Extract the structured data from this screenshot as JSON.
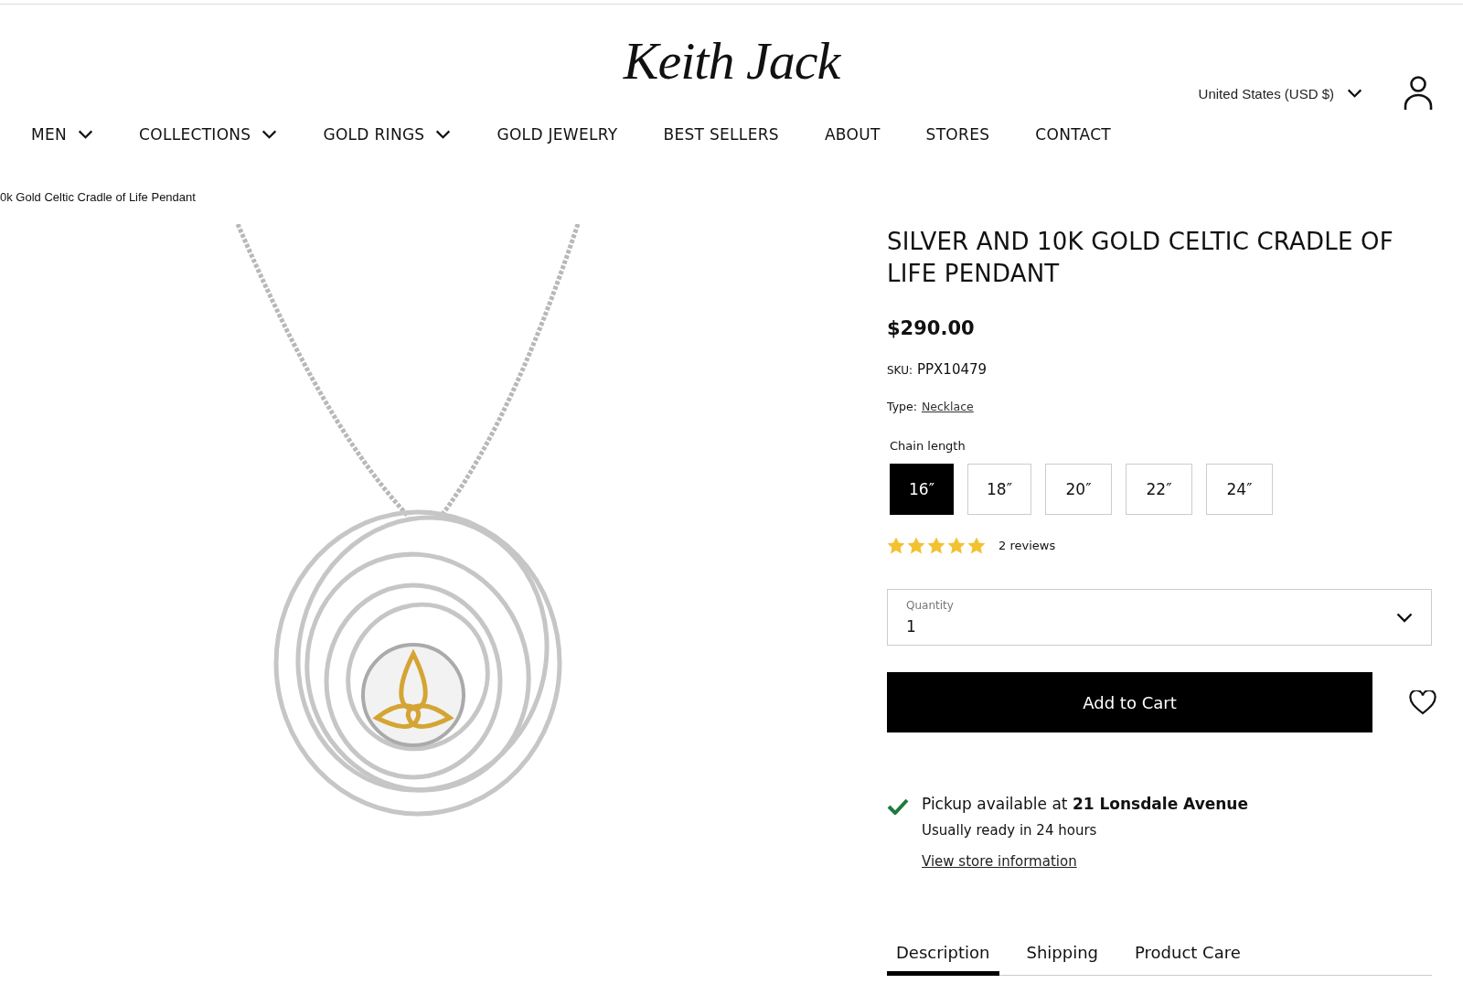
{
  "header": {
    "logo": "Keith Jack",
    "currency": "United States (USD $)"
  },
  "nav": [
    {
      "label": "MEN",
      "dropdown": true
    },
    {
      "label": "COLLECTIONS",
      "dropdown": true
    },
    {
      "label": "GOLD RINGS",
      "dropdown": true
    },
    {
      "label": "GOLD JEWELRY",
      "dropdown": false
    },
    {
      "label": "BEST SELLERS",
      "dropdown": false
    },
    {
      "label": "ABOUT",
      "dropdown": false
    },
    {
      "label": "STORES",
      "dropdown": false
    },
    {
      "label": "CONTACT",
      "dropdown": false
    }
  ],
  "breadcrumb": "0k Gold Celtic Cradle of Life Pendant",
  "product": {
    "title": "SILVER AND 10K GOLD CELTIC CRADLE OF LIFE PENDANT",
    "price": "$290.00",
    "sku_label": "SKU:",
    "sku": "PPX10479",
    "type_label": "Type:",
    "type": "Necklace",
    "option_label": "Chain length",
    "options": [
      {
        "label": "16″",
        "selected": true
      },
      {
        "label": "18″",
        "selected": false
      },
      {
        "label": "20″",
        "selected": false
      },
      {
        "label": "22″",
        "selected": false
      },
      {
        "label": "24″",
        "selected": false
      }
    ],
    "stars": 5,
    "reviews": "2 reviews",
    "quantity": {
      "label": "Quantity",
      "value": "1"
    },
    "add_to_cart": "Add to Cart",
    "pickup": {
      "text": "Pickup available at **21 Lonsdale Avenue**",
      "note": "Usually ready in 24 hours",
      "link": "View store information"
    },
    "tabs": [
      {
        "label": "Description",
        "selected": true
      },
      {
        "label": "Shipping",
        "selected": false
      },
      {
        "label": "Product Care",
        "selected": false
      }
    ]
  }
}
